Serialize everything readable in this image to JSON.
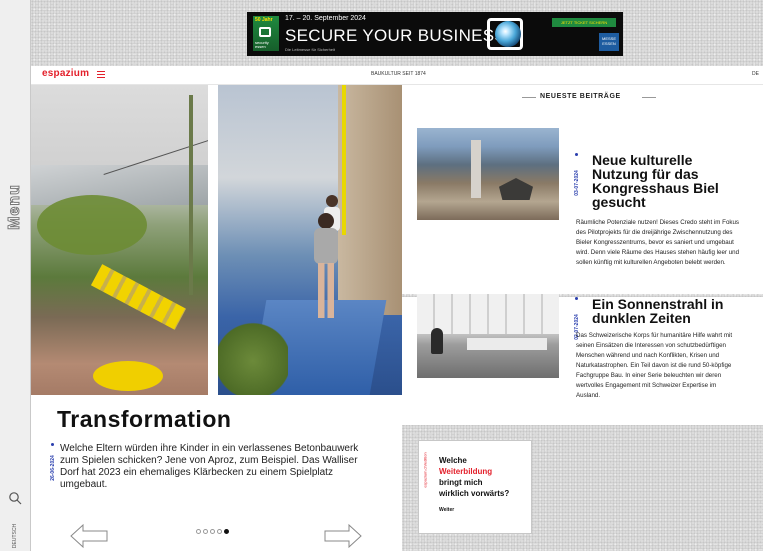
{
  "rail": {
    "menu_label": "Menu",
    "language_label": "DEUTSCH"
  },
  "banner": {
    "badge": "50 Jahr",
    "logo_text": "security\nessen",
    "dates": "17. – 20. September 2024",
    "slogan": "SECURE YOUR BUSINESS",
    "sub": "Die Leitmesse für Sicherheit",
    "ticket": "JETZT TICKET SICHERN",
    "messe": "MESSE\nESSEN"
  },
  "header": {
    "brand": "espazium",
    "tagline": "BAUKULTUR SEIT 1874",
    "lang": "DE"
  },
  "feature": {
    "title": "Transformation",
    "date": "26-06-2024",
    "excerpt": "Welche Eltern würden ihre Kinder in ein verlassenes Betonbauwerk zum Spielen schicken? Jene von Aproz, zum Beispiel. Das Walliser Dorf hat 2023 ein ehemaliges Klärbecken zu einem Spielplatz umgebaut.",
    "slides": 5,
    "active_slide": 5
  },
  "latest": {
    "heading": "NEUESTE BEITRÄGE",
    "articles": [
      {
        "date": "03-07-2024",
        "headline": "Neue kulturelle Nutzung für das Kongresshaus Biel gesucht",
        "body": "Räumliche Potenziale nutzen! Dieses Credo steht im Fokus des Pilotprojekts für die dreijährige Zwischennutzung des Bieler Kongresszentrums, bevor es saniert und umgebaut wird. Denn viele Räume des Hauses stehen häufig leer und sollen künftig mit kulturellen Angeboten belebt werden."
      },
      {
        "date": "02-07-2024",
        "headline": "Ein Sonnenstrahl in dunklen Zeiten",
        "body": "Das Schweizerische Korps für humanitäre Hilfe wahrt mit seinen Einsätzen die Interessen von schutzbedürftigen Menschen während und nach Konflikten, Krisen und Naturkatastrophen. Ein Teil davon ist die rund 50-köpfige Fachgruppe Bau. In einer Serie beleuchten wir deren wertvolles Engagement mit Schweizer Expertise im Ausland."
      }
    ]
  },
  "ad": {
    "side": "espazium.ch/edition",
    "q1": "Welche",
    "q2": "Weiterbildung",
    "q3": "bringt mich",
    "q4": "wirklich vorwärts?",
    "brand": "Weiter"
  },
  "colors": {
    "brand_red": "#e3202b",
    "date_blue": "#2a3fae"
  }
}
